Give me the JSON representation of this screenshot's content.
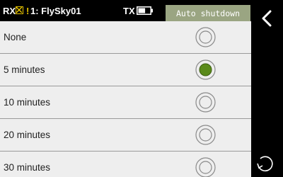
{
  "status_bar": {
    "rx_label": "RX",
    "rx_warning": "!",
    "model_name": "1: FlySky01",
    "tx_label": "TX",
    "tx_battery_icon": "battery-icon",
    "tx_battery_level": 0.6
  },
  "title": "Auto shutdown",
  "options": [
    {
      "label": "None",
      "selected": false
    },
    {
      "label": "5 minutes",
      "selected": true
    },
    {
      "label": "10 minutes",
      "selected": false
    },
    {
      "label": "20 minutes",
      "selected": false
    },
    {
      "label": "30 minutes",
      "selected": false
    }
  ],
  "icons": {
    "back": "chevron-left-icon",
    "reset": "rotate-icon"
  },
  "colors": {
    "background": "#000000",
    "list_background": "#eeeeee",
    "title_box": "#9aa582",
    "radio_selected": "#5a8a1a",
    "warning": "#e8c400",
    "divider": "#9a9a9a"
  }
}
